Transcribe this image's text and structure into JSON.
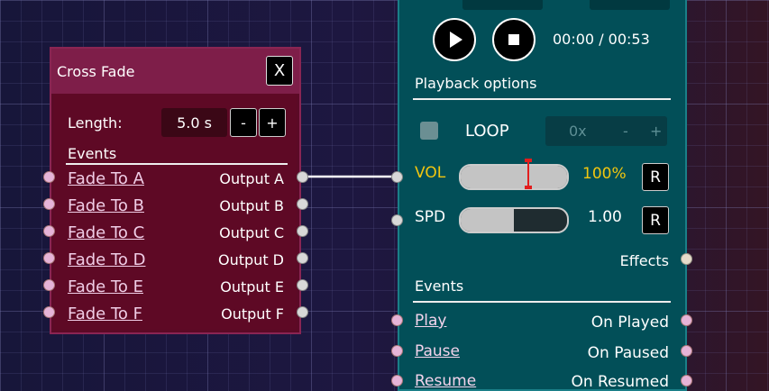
{
  "cross_fade": {
    "title": "Cross Fade",
    "close_label": "X",
    "length_label": "Length:",
    "length_value": "5.0 s",
    "minus_label": "-",
    "plus_label": "+",
    "events_title": "Events",
    "inputs": [
      "Fade To A",
      "Fade To B",
      "Fade To C",
      "Fade To D",
      "Fade To E",
      "Fade To F"
    ],
    "outputs": [
      "Output A",
      "Output B",
      "Output C",
      "Output D",
      "Output E",
      "Output F"
    ]
  },
  "audio": {
    "time": "00:00 / 00:53",
    "playback_title": "Playback options",
    "loop_label": "LOOP",
    "loop_count": "0x",
    "loop_minus": "-",
    "loop_plus": "+",
    "vol_label": "VOL",
    "vol_value": "100%",
    "vol_fill_fraction": 1.0,
    "spd_label": "SPD",
    "spd_value": "1.00",
    "spd_fill_fraction": 0.5,
    "reset_label": "R",
    "effects_label": "Effects",
    "events_title": "Events",
    "event_inputs": [
      "Play",
      "Pause",
      "Resume"
    ],
    "event_outputs": [
      "On Played",
      "On Paused",
      "On Resumed"
    ]
  },
  "colors": {
    "vol_accent": "#f2c60f",
    "marker": "#e21d1d",
    "cross_fade_bg": "#5e0925",
    "audio_bg": "#024f58"
  }
}
